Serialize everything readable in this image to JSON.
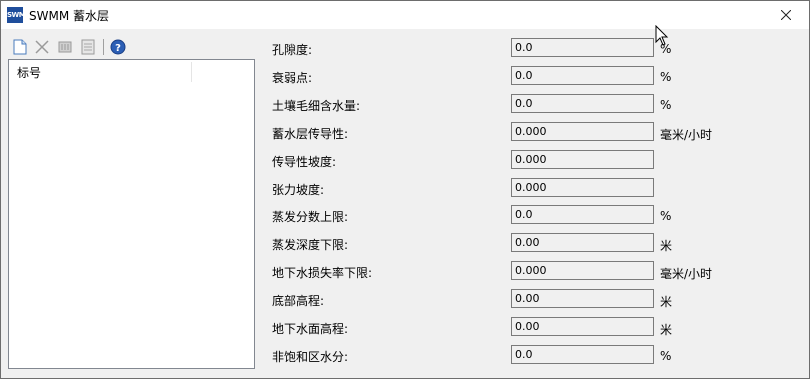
{
  "window": {
    "app_icon_text": "SWMM",
    "title": "SWMM 蓄水层",
    "close_glyph": "close-icon"
  },
  "toolbar": {
    "icons": [
      "new-icon",
      "delete-icon",
      "edit-icon",
      "paste-icon",
      "help-icon"
    ]
  },
  "list": {
    "header": "标号"
  },
  "properties": [
    {
      "label": "孔隙度:",
      "value": "0.0",
      "unit": "%"
    },
    {
      "label": "衰弱点:",
      "value": "0.0",
      "unit": "%"
    },
    {
      "label": "土壤毛细含水量:",
      "value": "0.0",
      "unit": "%"
    },
    {
      "label": "蓄水层传导性:",
      "value": "0.000",
      "unit": "毫米/小时"
    },
    {
      "label": "传导性坡度:",
      "value": "0.000",
      "unit": ""
    },
    {
      "label": "张力坡度:",
      "value": "0.000",
      "unit": ""
    },
    {
      "label": "蒸发分数上限:",
      "value": "0.0",
      "unit": "%"
    },
    {
      "label": "蒸发深度下限:",
      "value": "0.00",
      "unit": "米"
    },
    {
      "label": "地下水损失率下限:",
      "value": "0.000",
      "unit": "毫米/小时"
    },
    {
      "label": "底部高程:",
      "value": "0.00",
      "unit": "米"
    },
    {
      "label": "地下水面高程:",
      "value": "0.00",
      "unit": "米"
    },
    {
      "label": "非饱和区水分:",
      "value": "0.0",
      "unit": "%"
    }
  ]
}
